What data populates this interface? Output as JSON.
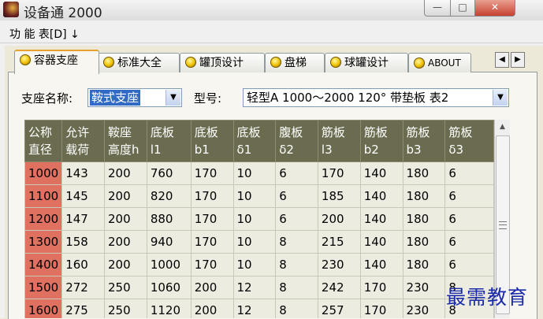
{
  "window": {
    "title": "设备通 2000",
    "btn_min": "—",
    "btn_max": "□",
    "btn_close": "✕"
  },
  "menu": {
    "function_table": "功 能 表[D] ↓"
  },
  "tabs": [
    {
      "label": "容器支座"
    },
    {
      "label": "标准大全"
    },
    {
      "label": "罐顶设计"
    },
    {
      "label": "盘梯"
    },
    {
      "label": "球罐设计"
    },
    {
      "label": "ABOUT"
    }
  ],
  "tab_scroll": {
    "left": "◀",
    "right": "▶"
  },
  "form": {
    "support_name_label": "支座名称:",
    "support_name_value": "鞍式支座",
    "model_label": "型号:",
    "model_value": "轻型A     1000～2000 120° 带垫板 表2",
    "arrow": "▼"
  },
  "table": {
    "headers": [
      [
        "公称",
        "直径"
      ],
      [
        "允许",
        "载荷"
      ],
      [
        "鞍座",
        "高度h"
      ],
      [
        "底板",
        "l1"
      ],
      [
        "底板",
        "b1"
      ],
      [
        "底板",
        "δ1"
      ],
      [
        "腹板",
        "δ2"
      ],
      [
        "筋板",
        "l3"
      ],
      [
        "筋板",
        "b2"
      ],
      [
        "筋板",
        "b3"
      ],
      [
        "筋板",
        "δ3"
      ]
    ],
    "rows": [
      [
        "1000",
        "143",
        "200",
        "760",
        "170",
        "10",
        "6",
        "170",
        "140",
        "180",
        "6"
      ],
      [
        "1100",
        "145",
        "200",
        "820",
        "170",
        "10",
        "6",
        "185",
        "140",
        "180",
        "6"
      ],
      [
        "1200",
        "147",
        "200",
        "880",
        "170",
        "10",
        "6",
        "200",
        "140",
        "180",
        "6"
      ],
      [
        "1300",
        "158",
        "200",
        "940",
        "170",
        "10",
        "8",
        "215",
        "140",
        "180",
        "6"
      ],
      [
        "1400",
        "160",
        "200",
        "1000",
        "170",
        "10",
        "8",
        "230",
        "140",
        "180",
        "6"
      ],
      [
        "1500",
        "272",
        "250",
        "1060",
        "200",
        "12",
        "8",
        "242",
        "170",
        "230",
        "8"
      ],
      [
        "1600",
        "275",
        "250",
        "1120",
        "200",
        "12",
        "8",
        "257",
        "170",
        "230",
        "8"
      ]
    ]
  },
  "scroll": {
    "up": "▲"
  },
  "watermark": "最需教育"
}
